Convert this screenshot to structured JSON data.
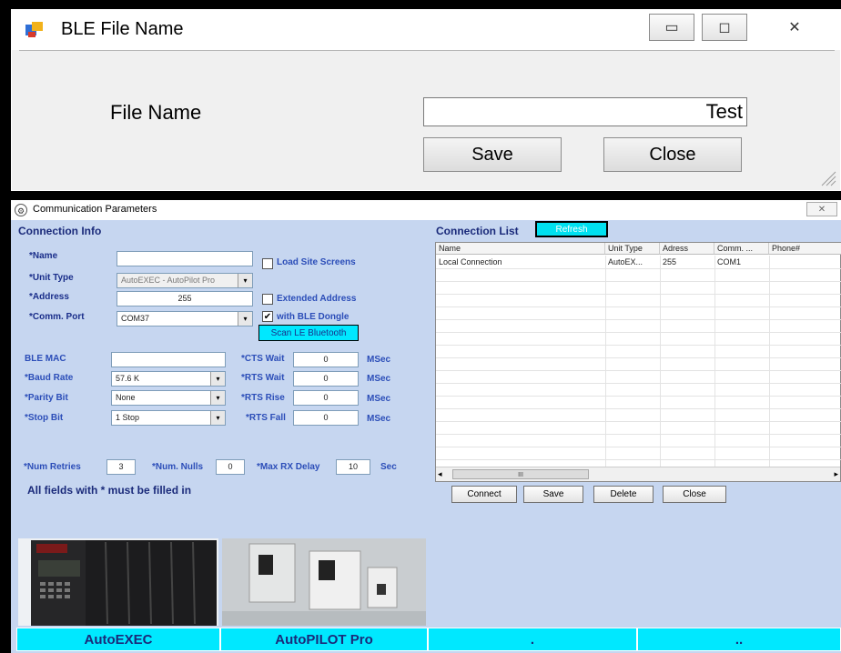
{
  "ble_dialog": {
    "title": "BLE File Name",
    "controls": {
      "minimize": "▭",
      "maximize": "◻",
      "close": "✕"
    },
    "file_name_label": "File Name",
    "file_name_value": "Test",
    "save_label": "Save",
    "close_label": "Close"
  },
  "comm_dialog": {
    "title": "Communication Parameters",
    "close_glyph": "✕",
    "connection_info": {
      "heading": "Connection Info",
      "name_label": "*Name",
      "name_value": "",
      "load_site_screens_label": "Load Site Screens",
      "load_site_screens_checked": false,
      "unit_type_label": "*Unit Type",
      "unit_type_value": "AutoEXEC - AutoPilot Pro",
      "address_label": "*Address",
      "address_value": "255",
      "extended_address_label": "Extended Address",
      "extended_address_checked": false,
      "comm_port_label": "*Comm. Port",
      "comm_port_value": "COM37",
      "with_ble_dongle_label": "with BLE Dongle",
      "with_ble_dongle_checked": true,
      "scan_button": "Scan LE Bluetooth",
      "ble_mac_label": "BLE MAC",
      "ble_mac_value": "",
      "baud_rate_label": "*Baud Rate",
      "baud_rate_value": "57.6 K",
      "parity_bit_label": "*Parity Bit",
      "parity_bit_value": "None",
      "stop_bit_label": "*Stop Bit",
      "stop_bit_value": "1 Stop",
      "cts_wait_label": "*CTS Wait",
      "cts_wait_value": "0",
      "rts_wait_label": "*RTS Wait",
      "rts_wait_value": "0",
      "rts_rise_label": "*RTS Rise",
      "rts_rise_value": "0",
      "rts_fall_label": "*RTS Fall",
      "rts_fall_value": "0",
      "msec": "MSec",
      "num_retries_label": "*Num Retries",
      "num_retries_value": "3",
      "num_nulls_label": "*Num. Nulls",
      "num_nulls_value": "0",
      "max_rx_delay_label": "*Max RX Delay",
      "max_rx_delay_value": "10",
      "sec": "Sec",
      "required_note": "All fields with * must be filled in"
    },
    "connection_list": {
      "heading": "Connection List",
      "refresh_button": "Refresh",
      "columns": [
        "Name",
        "Unit Type",
        "Adress",
        "Comm. ...",
        "Phone#"
      ],
      "rows": [
        [
          "Local Connection",
          "AutoEX...",
          "255",
          "COM1",
          ""
        ]
      ],
      "scroll_thumb": "III",
      "scroll_left": "◂",
      "scroll_right": "▸"
    },
    "buttons": {
      "connect": "Connect",
      "save": "Save",
      "delete": "Delete",
      "close": "Close"
    },
    "products": [
      {
        "name": "AutoEXEC",
        "image": "autoexec-controller-photo"
      },
      {
        "name": "AutoPILOT Pro",
        "image": "autopilot-pro-panels-photo"
      },
      {
        "name": ".",
        "image": ""
      },
      {
        "name": "..",
        "image": ""
      }
    ]
  }
}
